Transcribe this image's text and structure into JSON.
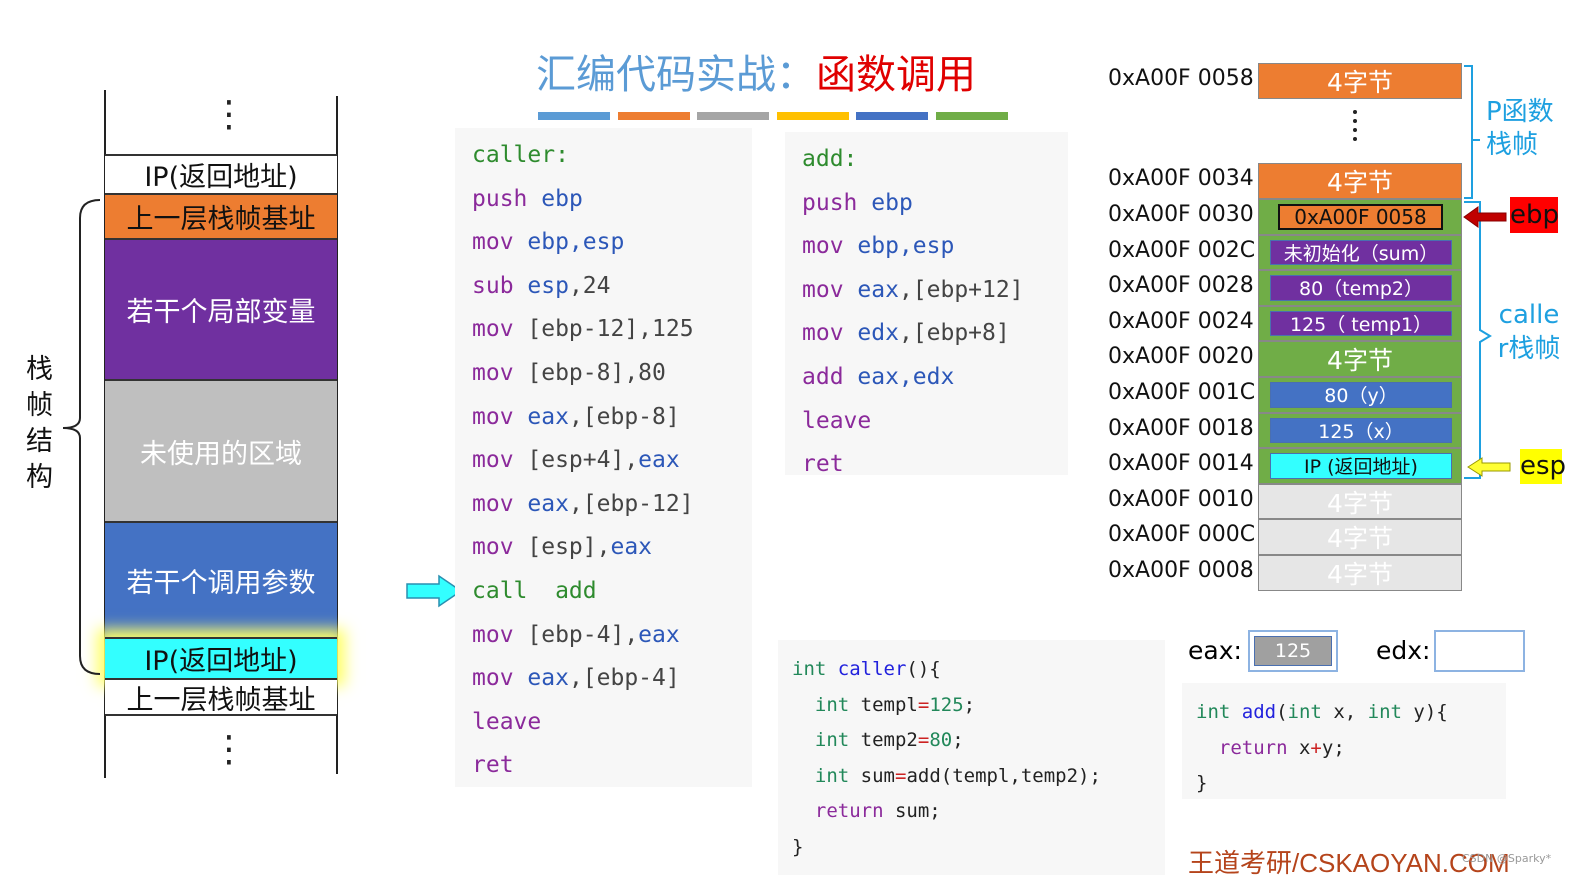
{
  "title": {
    "part1": "汇编代码实战：",
    "part2": "函数调用"
  },
  "colors": {
    "title_blue": "#5b9bd5",
    "title_red": "#e00000",
    "bar": [
      "#5b9bd5",
      "#ed7d31",
      "#a5a5a5",
      "#ffc000",
      "#4472c4",
      "#70ad47"
    ]
  },
  "left_stack": {
    "dots": "⋮",
    "rows": [
      "IP(返回地址)",
      "上一层栈帧基址",
      "若干个局部变量",
      "未使用的区域",
      "若干个调用参数",
      "IP(返回地址)",
      "上一层栈帧基址"
    ],
    "brace_label": "栈帧结构"
  },
  "caller_asm": [
    [
      [
        "lbl",
        "caller:"
      ]
    ],
    [
      [
        "op",
        "push "
      ],
      [
        "reg",
        "ebp"
      ]
    ],
    [
      [
        "op",
        "mov "
      ],
      [
        "reg",
        "ebp,esp"
      ]
    ],
    [
      [
        "op",
        "sub "
      ],
      [
        "reg",
        "esp"
      ],
      [
        "mem",
        ",24"
      ]
    ],
    [
      [
        "op",
        "mov "
      ],
      [
        "mem",
        "[ebp-12],125"
      ]
    ],
    [
      [
        "op",
        "mov "
      ],
      [
        "mem",
        "[ebp-8],80"
      ]
    ],
    [
      [
        "op",
        "mov "
      ],
      [
        "reg",
        "eax"
      ],
      [
        "mem",
        ",[ebp-8]"
      ]
    ],
    [
      [
        "op",
        "mov "
      ],
      [
        "mem",
        "[esp+4],"
      ],
      [
        "reg",
        "eax"
      ]
    ],
    [
      [
        "op",
        "mov "
      ],
      [
        "reg",
        "eax"
      ],
      [
        "mem",
        ",[ebp-12]"
      ]
    ],
    [
      [
        "op",
        "mov "
      ],
      [
        "mem",
        "[esp],"
      ],
      [
        "reg",
        "eax"
      ]
    ],
    [
      [
        "lbl",
        "call  add"
      ]
    ],
    [
      [
        "op",
        "mov "
      ],
      [
        "mem",
        "[ebp-4],"
      ],
      [
        "reg",
        "eax"
      ]
    ],
    [
      [
        "op",
        "mov "
      ],
      [
        "reg",
        "eax"
      ],
      [
        "mem",
        ",[ebp-4]"
      ]
    ],
    [
      [
        "op",
        "leave"
      ]
    ],
    [
      [
        "op",
        "ret"
      ]
    ]
  ],
  "add_asm": [
    [
      [
        "lbl",
        "add:"
      ]
    ],
    [
      [
        "op",
        "push "
      ],
      [
        "reg",
        "ebp"
      ]
    ],
    [
      [
        "op",
        "mov "
      ],
      [
        "reg",
        "ebp,esp"
      ]
    ],
    [
      [
        "op",
        "mov "
      ],
      [
        "reg",
        "eax"
      ],
      [
        "mem",
        ",[ebp+12]"
      ]
    ],
    [
      [
        "op",
        "mov "
      ],
      [
        "reg",
        "edx"
      ],
      [
        "mem",
        ",[ebp+8]"
      ]
    ],
    [
      [
        "op",
        "add "
      ],
      [
        "reg",
        "eax,edx"
      ]
    ],
    [
      [
        "op",
        "leave"
      ]
    ],
    [
      [
        "op",
        "ret"
      ]
    ]
  ],
  "caller_c": [
    [
      [
        "int",
        "int "
      ],
      [
        "fn",
        "caller"
      ],
      [
        "",
        "(){"
      ]
    ],
    [
      [
        "",
        "  "
      ],
      [
        "int",
        "int "
      ],
      [
        "",
        "templ"
      ],
      [
        "eq",
        "="
      ],
      [
        "int",
        "125"
      ],
      [
        "",
        ";"
      ]
    ],
    [
      [
        "",
        "  "
      ],
      [
        "int",
        "int "
      ],
      [
        "",
        "temp2"
      ],
      [
        "eq",
        "="
      ],
      [
        "int",
        "80"
      ],
      [
        "",
        ";"
      ]
    ],
    [
      [
        "",
        "  "
      ],
      [
        "int",
        "int "
      ],
      [
        "",
        "sum"
      ],
      [
        "eq",
        "="
      ],
      [
        "",
        "add(templ,temp2);"
      ]
    ],
    [
      [
        "",
        "  "
      ],
      [
        "ret",
        "return "
      ],
      [
        "",
        "sum;"
      ]
    ],
    [
      [
        "",
        "}"
      ]
    ]
  ],
  "add_c": [
    [
      [
        "int",
        "int "
      ],
      [
        "fn",
        "add"
      ],
      [
        "",
        "("
      ],
      [
        "int",
        "int "
      ],
      [
        "",
        "x, "
      ],
      [
        "int",
        "int "
      ],
      [
        "",
        "y){"
      ]
    ],
    [
      [
        "",
        "  "
      ],
      [
        "ret",
        "return "
      ],
      [
        "",
        "x"
      ],
      [
        "eq",
        "+"
      ],
      [
        "",
        "y;"
      ]
    ],
    [
      [
        "",
        "}"
      ]
    ]
  ],
  "registers": {
    "eax_label": "eax:",
    "eax_value": "125",
    "edx_label": "edx:",
    "edx_value": ""
  },
  "memory": {
    "top": {
      "addr": "0xA00F 0058",
      "label": "4字节"
    },
    "rows": [
      {
        "addr": "0xA00F 0034",
        "label": "4字节",
        "kind": "orange"
      },
      {
        "addr": "0xA00F 0030",
        "label": "0xA00F 0058",
        "kind": "saved-ebp"
      },
      {
        "addr": "0xA00F 002C",
        "label": "未初始化（sum）",
        "kind": "local"
      },
      {
        "addr": "0xA00F 0028",
        "label": "80（temp2）",
        "kind": "local"
      },
      {
        "addr": "0xA00F 0024",
        "label": "125（ temp1）",
        "kind": "local"
      },
      {
        "addr": "0xA00F 0020",
        "label": "4字节",
        "kind": "green"
      },
      {
        "addr": "0xA00F 001C",
        "label": "80（y）",
        "kind": "arg"
      },
      {
        "addr": "0xA00F 0018",
        "label": "125（x）",
        "kind": "arg"
      },
      {
        "addr": "0xA00F 0014",
        "label": "IP (返回地址)",
        "kind": "ip"
      },
      {
        "addr": "0xA00F 0010",
        "label": "4字节",
        "kind": "unused"
      },
      {
        "addr": "0xA00F 000C",
        "label": "4字节",
        "kind": "unused"
      },
      {
        "addr": "0xA00F 0008",
        "label": "4字节",
        "kind": "unused"
      }
    ],
    "p_frame_label": "P函数栈帧",
    "caller_frame_label": "caller栈帧",
    "ebp_label": "ebp",
    "esp_label": "esp"
  },
  "footer": {
    "brand": "王道考研/CSKAOYAN.COM",
    "credit": "CSDN @Sparky*"
  }
}
